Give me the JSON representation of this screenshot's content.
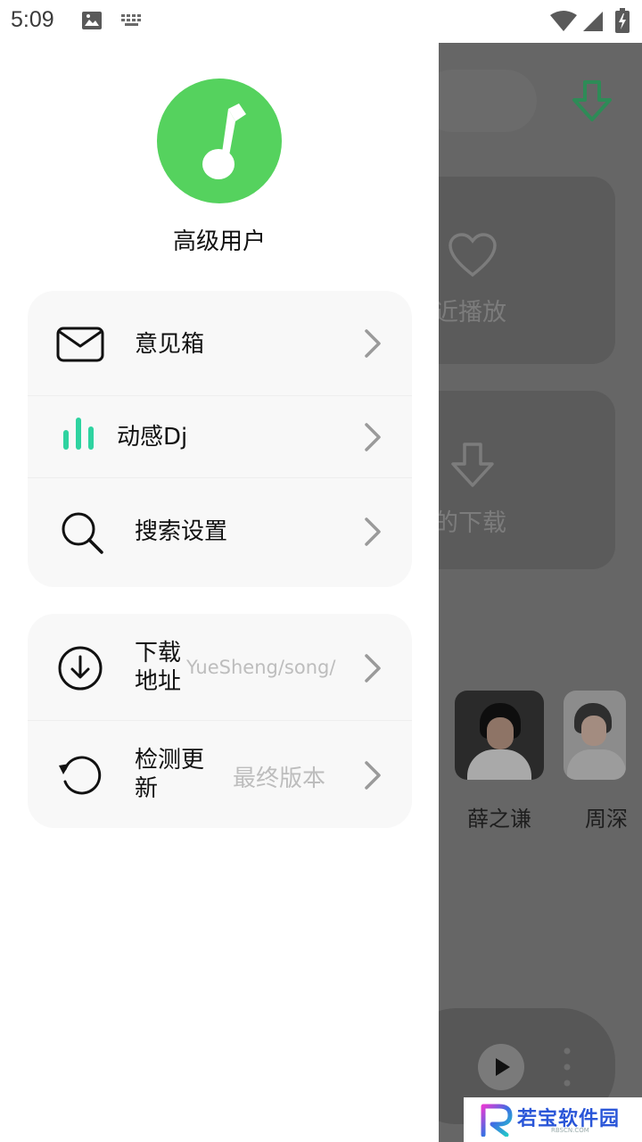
{
  "status_bar": {
    "time": "5:09"
  },
  "drawer": {
    "user_name": "高级用户",
    "group1": [
      {
        "label": "意见箱"
      },
      {
        "label": "动感Dj"
      },
      {
        "label": "搜索设置"
      }
    ],
    "group2": [
      {
        "label": "下载地址",
        "value": "YueSheng/song/"
      },
      {
        "label": "检测更新",
        "value": "最终版本"
      }
    ]
  },
  "background": {
    "card_recent": "最近播放",
    "card_downloads": "我的下载",
    "artists": [
      {
        "name": "薛之谦"
      },
      {
        "name": "周深"
      }
    ]
  },
  "watermark": {
    "name": "若宝软件园",
    "url": "RBSCN.COM"
  },
  "colors": {
    "accent_green": "#55d25e",
    "dj_bars": "#2ed3a0",
    "download_arrow": "#2e8b57"
  }
}
